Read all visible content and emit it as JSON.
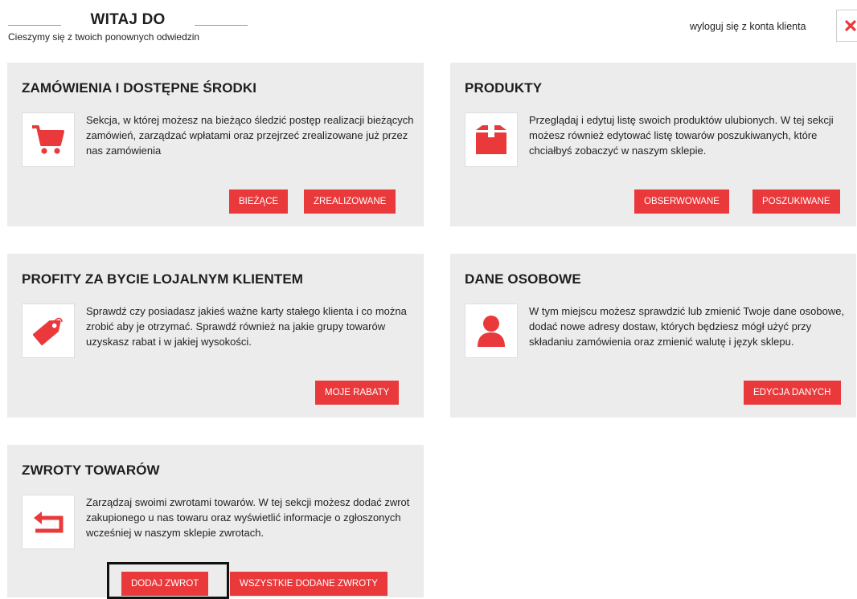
{
  "header": {
    "title": "WITAJ DO",
    "subtitle": "Cieszymy się z twoich ponownych odwiedzin",
    "logout_label": "wyloguj się z konta klienta"
  },
  "colors": {
    "accent": "#e9393b",
    "panel": "#ececec"
  },
  "cards": [
    {
      "title": "ZAMÓWIENIA I DOSTĘPNE ŚRODKI",
      "icon": "shopping-cart-icon",
      "description": "Sekcja, w której możesz na bieżąco śledzić postęp realizacji bieżących zamówień, zarządzać wpłatami oraz przejrzeć zrealizowane już przez nas zamówienia",
      "buttons": [
        "BIEŻĄCE",
        "ZREALIZOWANE"
      ]
    },
    {
      "title": "PRODUKTY",
      "icon": "box-icon",
      "description": "Przeglądaj i edytuj listę swoich produktów ulubionych. W tej sekcji możesz również edytować listę towarów poszukiwanych, które chciałbyś zobaczyć w naszym sklepie.",
      "buttons": [
        "OBSERWOWANE",
        "POSZUKIWANE"
      ]
    },
    {
      "title": "PROFITY ZA BYCIE LOJALNYM KLIENTEM",
      "icon": "price-tag-icon",
      "description": "Sprawdź czy posiadasz jakieś ważne karty stałego klienta i co można zrobić aby je otrzymać. Sprawdź również na jakie grupy towarów uzyskasz rabat i w jakiej wysokości.",
      "buttons": [
        "MOJE RABATY"
      ]
    },
    {
      "title": "DANE OSOBOWE",
      "icon": "user-icon",
      "description": "W tym miejscu możesz sprawdzić lub zmienić Twoje dane osobowe, dodać nowe adresy dostaw, których będziesz mógł użyć przy składaniu zamówienia oraz zmienić walutę i język sklepu.",
      "buttons": [
        "EDYCJA DANYCH"
      ]
    },
    {
      "title": "ZWROTY TOWARÓW",
      "icon": "return-arrow-icon",
      "description": "Zarządzaj swoimi zwrotami towarów. W tej sekcji możesz dodać zwrot zakupionego u nas towaru oraz wyświetlić informacje o zgłoszonych wcześniej w naszym sklepie zwrotach.",
      "buttons": [
        "DODAJ ZWROT",
        "WSZYSTKIE DODANE ZWROTY"
      ]
    }
  ]
}
